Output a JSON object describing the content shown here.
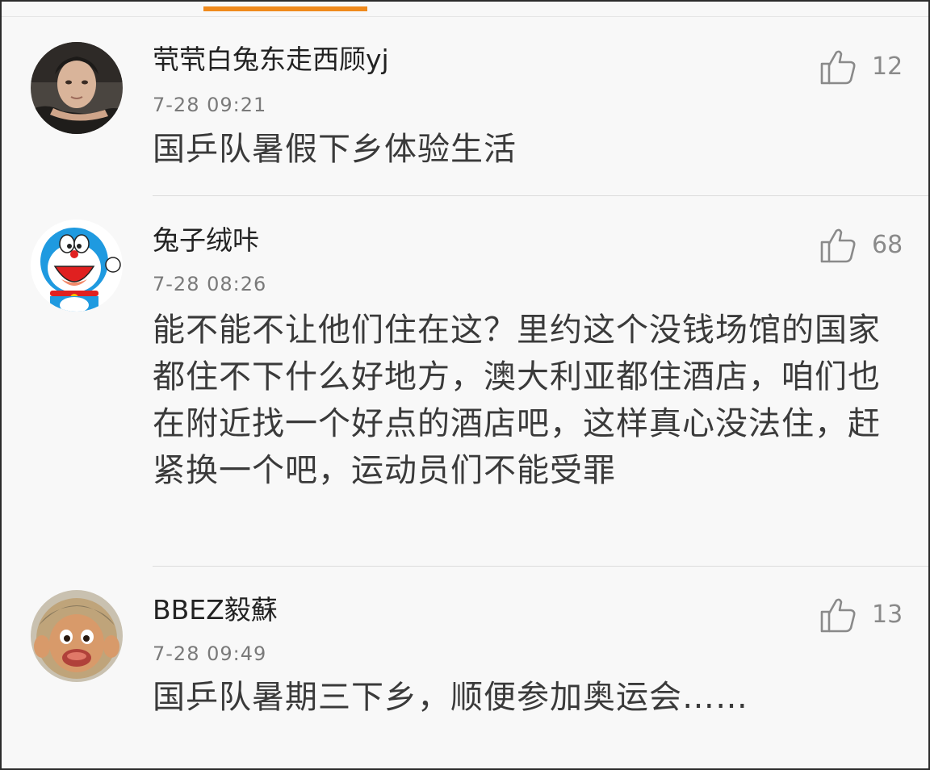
{
  "comments": [
    {
      "username": "茕茕白兔东走西顾yj",
      "time": "7-28 09:21",
      "likes": "12",
      "text": "国乒队暑假下乡体验生活",
      "avatar_icon": "man-portrait-avatar"
    },
    {
      "username": "兔子绒咔",
      "time": "7-28 08:26",
      "likes": "68",
      "text": "能不能不让他们住在这？里约这个没钱场馆的国家都住不下什么好地方，澳大利亚都住酒店，咱们也在附近找一个好点的酒店吧，这样真心没法住，赶紧换一个吧，运动员们不能受罪",
      "avatar_icon": "doraemon-avatar"
    },
    {
      "username": "BBEZ毅蘇",
      "time": "7-28 09:49",
      "likes": "13",
      "text": "国乒队暑期三下乡，顺便参加奥运会……",
      "avatar_icon": "cartoon-monkey-avatar"
    }
  ],
  "colors": {
    "tab_indicator": "#f08a1c",
    "like_icon": "#8a8a8a"
  }
}
